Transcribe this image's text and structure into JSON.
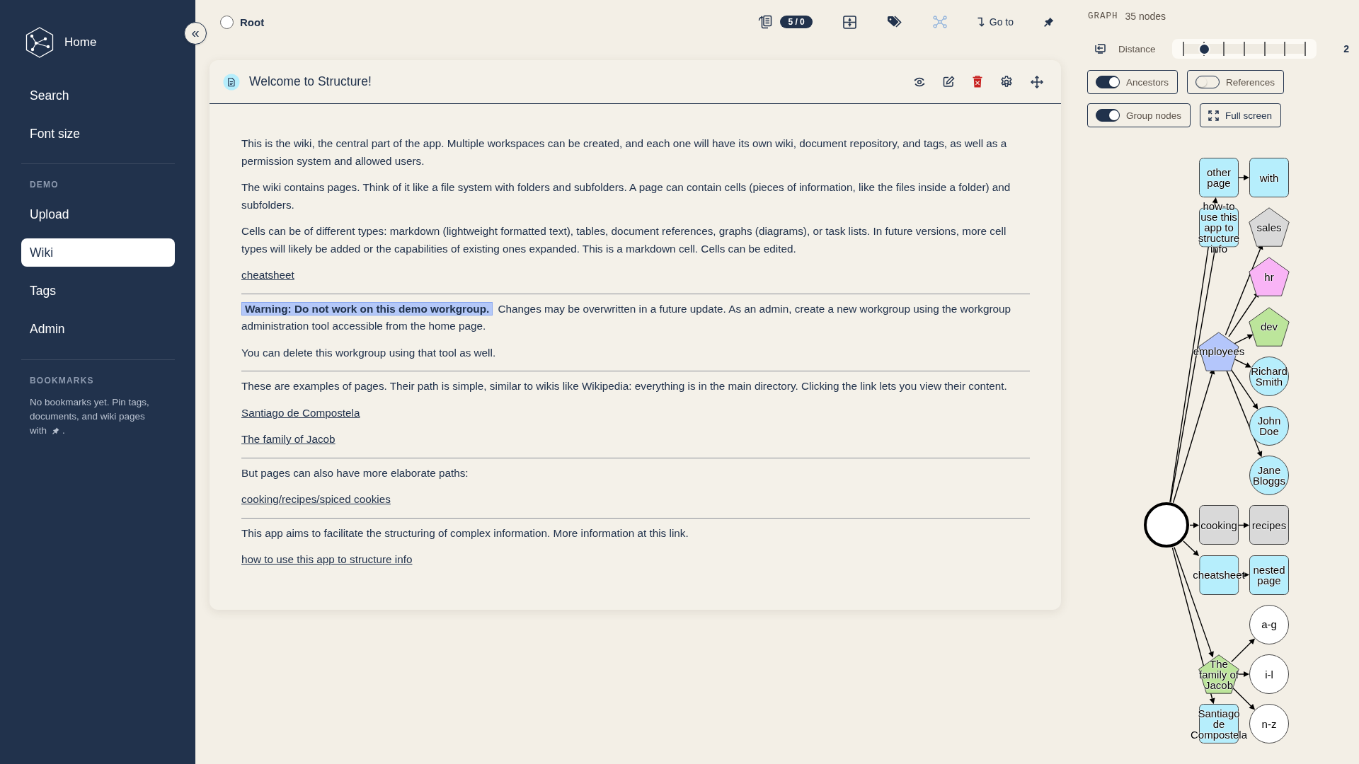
{
  "sidebar": {
    "brand": "Home",
    "collapse_button": "«",
    "items": [
      {
        "label": "Search",
        "selected": false
      },
      {
        "label": "Font size",
        "selected": false
      }
    ],
    "sections": [
      {
        "title": "DEMO",
        "items": [
          {
            "label": "Upload",
            "selected": false
          },
          {
            "label": "Wiki",
            "selected": true
          },
          {
            "label": "Tags",
            "selected": false
          },
          {
            "label": "Admin",
            "selected": false
          }
        ]
      }
    ],
    "bookmarks": {
      "title": "BOOKMARKS",
      "hint": "No bookmarks yet. Pin tags, documents, and wiki pages with",
      "hint_end": "."
    }
  },
  "topbar": {
    "breadcrumb": {
      "label": "Root",
      "checked": false
    },
    "toolbar": [
      {
        "kind": "documents",
        "badge": "5 / 0",
        "selected": false
      },
      {
        "kind": "layout",
        "selected": false
      },
      {
        "kind": "tags",
        "selected": false
      },
      {
        "kind": "graph",
        "selected": true
      },
      {
        "kind": "goto",
        "label": "Go to",
        "selected": false
      },
      {
        "kind": "pin",
        "selected": false
      }
    ]
  },
  "card": {
    "title": "Welcome to Structure!",
    "actions": [
      {
        "kind": "view"
      },
      {
        "kind": "edit"
      },
      {
        "kind": "delete"
      },
      {
        "kind": "settings"
      },
      {
        "kind": "move"
      }
    ],
    "sections": [
      [
        {
          "kind": "paragraph",
          "text": "This is the wiki, the central part of the app. Multiple workspaces can be created, and each one will have its own wiki, document repository, and tags, as well as a permission system and allowed users."
        },
        {
          "kind": "paragraph",
          "text": "The wiki contains pages. Think of it like a file system with folders and subfolders. A page can contain cells (pieces of information, like the files inside a folder) and subfolders."
        },
        {
          "kind": "paragraph",
          "text": "Cells can be of different types: markdown (lightweight formatted text), tables, document references, graphs (diagrams), or task lists. In future versions, more cell types will likely be added or the capabilities of existing ones expanded. This is a markdown cell. Cells can be edited."
        },
        {
          "kind": "link",
          "text": "cheatsheet"
        }
      ],
      [
        {
          "kind": "paragraph",
          "text": "**Warning: Do not work on this demo workgroup.** Changes may be overwritten in a future update. As an admin, create a new workgroup using the workgroup administration tool accessible from the home page."
        },
        {
          "kind": "paragraph",
          "text": "You can delete this workgroup using that tool as well."
        }
      ],
      [
        {
          "kind": "paragraph",
          "text": "These are examples of pages. Their path is simple, similar to wikis like Wikipedia: everything is in the main directory. Clicking the link lets you view their content."
        },
        {
          "kind": "link",
          "text": "Santiago de Compostela"
        },
        {
          "kind": "link",
          "text": "The family of Jacob"
        }
      ],
      [
        {
          "kind": "paragraph",
          "text": "But pages can also have more elaborate paths:"
        },
        {
          "kind": "link",
          "text": "cooking/recipes/spiced cookies"
        }
      ],
      [
        {
          "kind": "paragraph",
          "text": "This app aims to facilitate the structuring of complex information. More information at this link."
        },
        {
          "kind": "link",
          "text": "how to use this app to structure info"
        }
      ]
    ]
  },
  "graph": {
    "title": "GRAPH",
    "count": "35 nodes",
    "distance": {
      "label": "Distance",
      "level": 0.17,
      "reading": "2"
    },
    "options": [
      {
        "kind": "toggle",
        "label": "Ancestors",
        "on": true
      },
      {
        "kind": "toggle",
        "label": "References",
        "on": false
      },
      {
        "kind": "toggle",
        "label": "Group nodes",
        "on": true
      },
      {
        "kind": "button",
        "label": "Full screen"
      }
    ],
    "root": {
      "kind": "root",
      "color": "#ffffff",
      "children": [
        {
          "label": "other page",
          "kind": "page",
          "color": "#b6eefc",
          "children": [
            {
              "label": "with",
              "kind": "page",
              "color": "#b6eefc"
            }
          ]
        },
        {
          "label": "how-to use this app to structure info",
          "kind": "page",
          "color": "#b6eefc"
        },
        {
          "label": "employees",
          "kind": "tag",
          "color": "#b4c6fb",
          "children": [
            {
              "label": "sales",
              "kind": "tag",
              "color": "#d9d9d9"
            },
            {
              "label": "hr",
              "kind": "tag",
              "color": "#f9b4f6"
            },
            {
              "label": "dev",
              "kind": "tag",
              "color": "#bce59b"
            },
            {
              "label": "Richard Smith",
              "kind": "person",
              "color": "#b6eefc"
            },
            {
              "label": "John Doe",
              "kind": "person",
              "color": "#b6eefc"
            },
            {
              "label": "Jane Bloggs",
              "kind": "person",
              "color": "#b6eefc"
            }
          ]
        },
        {
          "label": "cooking",
          "kind": "page",
          "color": "#d9d9d9",
          "children": [
            {
              "label": "recipes",
              "kind": "page",
              "color": "#d9d9d9"
            }
          ]
        },
        {
          "label": "cheatsheet",
          "kind": "page",
          "color": "#b6eefc",
          "children": [
            {
              "label": "nested page",
              "kind": "page",
              "color": "#b6eefc"
            }
          ]
        },
        {
          "label": "The family of Jacob",
          "kind": "tag",
          "color": "#bce59b",
          "children": [
            {
              "label": "a-g",
              "kind": "group",
              "color": "#ffffff"
            },
            {
              "label": "i-l",
              "kind": "group",
              "color": "#ffffff"
            },
            {
              "label": "n-z",
              "kind": "group",
              "color": "#ffffff"
            }
          ]
        },
        {
          "label": "Santiago de Compostela",
          "kind": "page",
          "color": "#b6eefc"
        }
      ]
    }
  }
}
